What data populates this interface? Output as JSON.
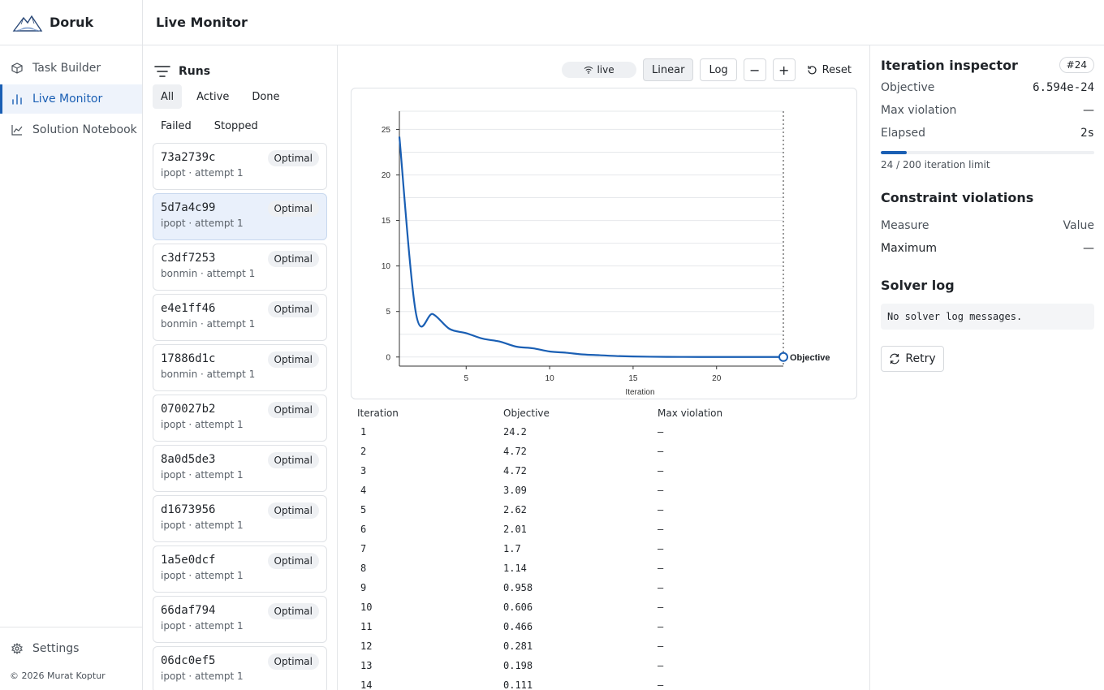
{
  "brand": {
    "name": "Doruk"
  },
  "header": {
    "title": "Live Monitor"
  },
  "sidebar": {
    "items": [
      {
        "label": "Task Builder",
        "icon": "cube-icon",
        "active": false
      },
      {
        "label": "Live Monitor",
        "icon": "bar-chart-icon",
        "active": true
      },
      {
        "label": "Solution Notebook",
        "icon": "line-chart-icon",
        "active": false
      }
    ],
    "settings_label": "Settings",
    "copyright": "© 2026 Murat Koptur"
  },
  "runs": {
    "title": "Runs",
    "filters": [
      "All",
      "Active",
      "Done",
      "Failed",
      "Stopped"
    ],
    "active_filter": "All",
    "items": [
      {
        "id": "73a2739c",
        "meta": "ipopt · attempt 1",
        "status": "Optimal"
      },
      {
        "id": "5d7a4c99",
        "meta": "ipopt · attempt 1",
        "status": "Optimal",
        "selected": true
      },
      {
        "id": "c3df7253",
        "meta": "bonmin · attempt 1",
        "status": "Optimal"
      },
      {
        "id": "e4e1ff46",
        "meta": "bonmin · attempt 1",
        "status": "Optimal"
      },
      {
        "id": "17886d1c",
        "meta": "bonmin · attempt 1",
        "status": "Optimal"
      },
      {
        "id": "070027b2",
        "meta": "ipopt · attempt 1",
        "status": "Optimal"
      },
      {
        "id": "8a0d5de3",
        "meta": "ipopt · attempt 1",
        "status": "Optimal"
      },
      {
        "id": "d1673956",
        "meta": "ipopt · attempt 1",
        "status": "Optimal"
      },
      {
        "id": "1a5e0dcf",
        "meta": "ipopt · attempt 1",
        "status": "Optimal"
      },
      {
        "id": "66daf794",
        "meta": "ipopt · attempt 1",
        "status": "Optimal"
      },
      {
        "id": "06dc0ef5",
        "meta": "ipopt · attempt 1",
        "status": "Optimal"
      }
    ]
  },
  "toolbar": {
    "live_label": "live",
    "linear_label": "Linear",
    "log_label": "Log",
    "zoom_out_label": "−",
    "zoom_in_label": "+",
    "reset_label": "Reset",
    "scale": "Linear"
  },
  "chart_data": {
    "type": "line",
    "xlabel": "Iteration",
    "ylabel": "",
    "xlim": [
      1,
      24
    ],
    "ylim": [
      -1,
      27
    ],
    "xticks": [
      5,
      10,
      15,
      20
    ],
    "yticks": [
      0,
      5,
      10,
      15,
      20,
      25
    ],
    "grid": true,
    "series": [
      {
        "name": "Objective",
        "color": "#1a5fb4",
        "x": [
          1,
          2,
          3,
          4,
          5,
          6,
          7,
          8,
          9,
          10,
          11,
          12,
          13,
          14,
          15,
          16,
          17,
          18,
          19,
          20,
          21,
          22,
          23,
          24
        ],
        "y": [
          24.2,
          4.72,
          4.72,
          3.09,
          2.62,
          2.01,
          1.7,
          1.14,
          0.958,
          0.606,
          0.466,
          0.281,
          0.198,
          0.111,
          0.06,
          0.03,
          0.015,
          0.008,
          0.004,
          0.002,
          0.001,
          0.0005,
          0.0002,
          0.0
        ]
      }
    ],
    "marker_at_last": true
  },
  "table": {
    "headers": [
      "Iteration",
      "Objective",
      "Max violation"
    ],
    "rows": [
      [
        "1",
        "24.2",
        "—"
      ],
      [
        "2",
        "4.72",
        "—"
      ],
      [
        "3",
        "4.72",
        "—"
      ],
      [
        "4",
        "3.09",
        "—"
      ],
      [
        "5",
        "2.62",
        "—"
      ],
      [
        "6",
        "2.01",
        "—"
      ],
      [
        "7",
        "1.7",
        "—"
      ],
      [
        "8",
        "1.14",
        "—"
      ],
      [
        "9",
        "0.958",
        "—"
      ],
      [
        "10",
        "0.606",
        "—"
      ],
      [
        "11",
        "0.466",
        "—"
      ],
      [
        "12",
        "0.281",
        "—"
      ],
      [
        "13",
        "0.198",
        "—"
      ],
      [
        "14",
        "0.111",
        "—"
      ]
    ]
  },
  "inspector": {
    "title": "Iteration inspector",
    "iteration_badge": "#24",
    "objective_label": "Objective",
    "objective_value": "6.594e-24",
    "max_violation_label": "Max violation",
    "max_violation_value": "—",
    "elapsed_label": "Elapsed",
    "elapsed_value": "2s",
    "progress_fraction": 0.12,
    "progress_label": "24 / 200 iteration limit",
    "constraints_title": "Constraint violations",
    "measure_label": "Measure",
    "value_label": "Value",
    "maximum_label": "Maximum",
    "maximum_value": "—",
    "log_title": "Solver log",
    "log_message": "No solver log messages.",
    "retry_label": "Retry"
  },
  "colors": {
    "accent": "#1a5fb4",
    "badge_bg": "#eef0f3",
    "border": "#e3e5e8"
  }
}
